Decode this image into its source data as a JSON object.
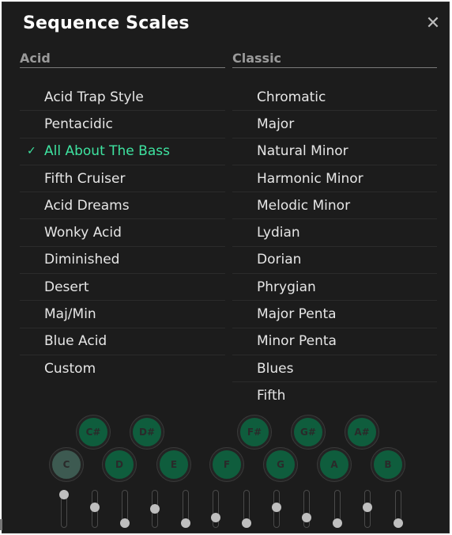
{
  "dialog": {
    "title": "Sequence Scales",
    "close_icon": "close-icon"
  },
  "columns": {
    "acid": {
      "header": "Acid",
      "items": [
        {
          "label": "Acid Trap Style",
          "selected": false
        },
        {
          "label": "Pentacidic",
          "selected": false
        },
        {
          "label": "All About The Bass",
          "selected": true
        },
        {
          "label": "Fifth Cruiser",
          "selected": false
        },
        {
          "label": "Acid Dreams",
          "selected": false
        },
        {
          "label": "Wonky Acid",
          "selected": false
        },
        {
          "label": "Diminished",
          "selected": false
        },
        {
          "label": "Desert",
          "selected": false
        },
        {
          "label": "Maj/Min",
          "selected": false
        },
        {
          "label": "Blue Acid",
          "selected": false
        },
        {
          "label": "Custom",
          "selected": false
        }
      ]
    },
    "classic": {
      "header": "Classic",
      "items": [
        {
          "label": "Chromatic",
          "selected": false
        },
        {
          "label": "Major",
          "selected": false
        },
        {
          "label": "Natural Minor",
          "selected": false
        },
        {
          "label": "Harmonic Minor",
          "selected": false
        },
        {
          "label": "Melodic Minor",
          "selected": false
        },
        {
          "label": "Lydian",
          "selected": false
        },
        {
          "label": "Dorian",
          "selected": false
        },
        {
          "label": "Phrygian",
          "selected": false
        },
        {
          "label": "Major Penta",
          "selected": false
        },
        {
          "label": "Minor Penta",
          "selected": false
        },
        {
          "label": "Blues",
          "selected": false
        },
        {
          "label": "Fifth",
          "selected": false
        }
      ]
    }
  },
  "check_mark": "✓",
  "keyboard": {
    "notes": [
      {
        "name": "C",
        "root": true
      },
      {
        "name": "C#",
        "root": false
      },
      {
        "name": "D",
        "root": false
      },
      {
        "name": "D#",
        "root": false
      },
      {
        "name": "E",
        "root": false
      },
      {
        "name": "F",
        "root": false
      },
      {
        "name": "F#",
        "root": false
      },
      {
        "name": "G",
        "root": false
      },
      {
        "name": "G#",
        "root": false
      },
      {
        "name": "A",
        "root": false
      },
      {
        "name": "A#",
        "root": false
      },
      {
        "name": "B",
        "root": false
      }
    ],
    "levels": [
      1.0,
      0.55,
      0.0,
      0.5,
      0.0,
      0.2,
      0.0,
      0.55,
      0.2,
      0.0,
      0.55,
      0.0
    ]
  },
  "colors": {
    "accent": "#3ee3a0",
    "key_active": "#0f5d3d",
    "key_root": "#3d5a51",
    "panel_bg": "#1c1c1c"
  }
}
